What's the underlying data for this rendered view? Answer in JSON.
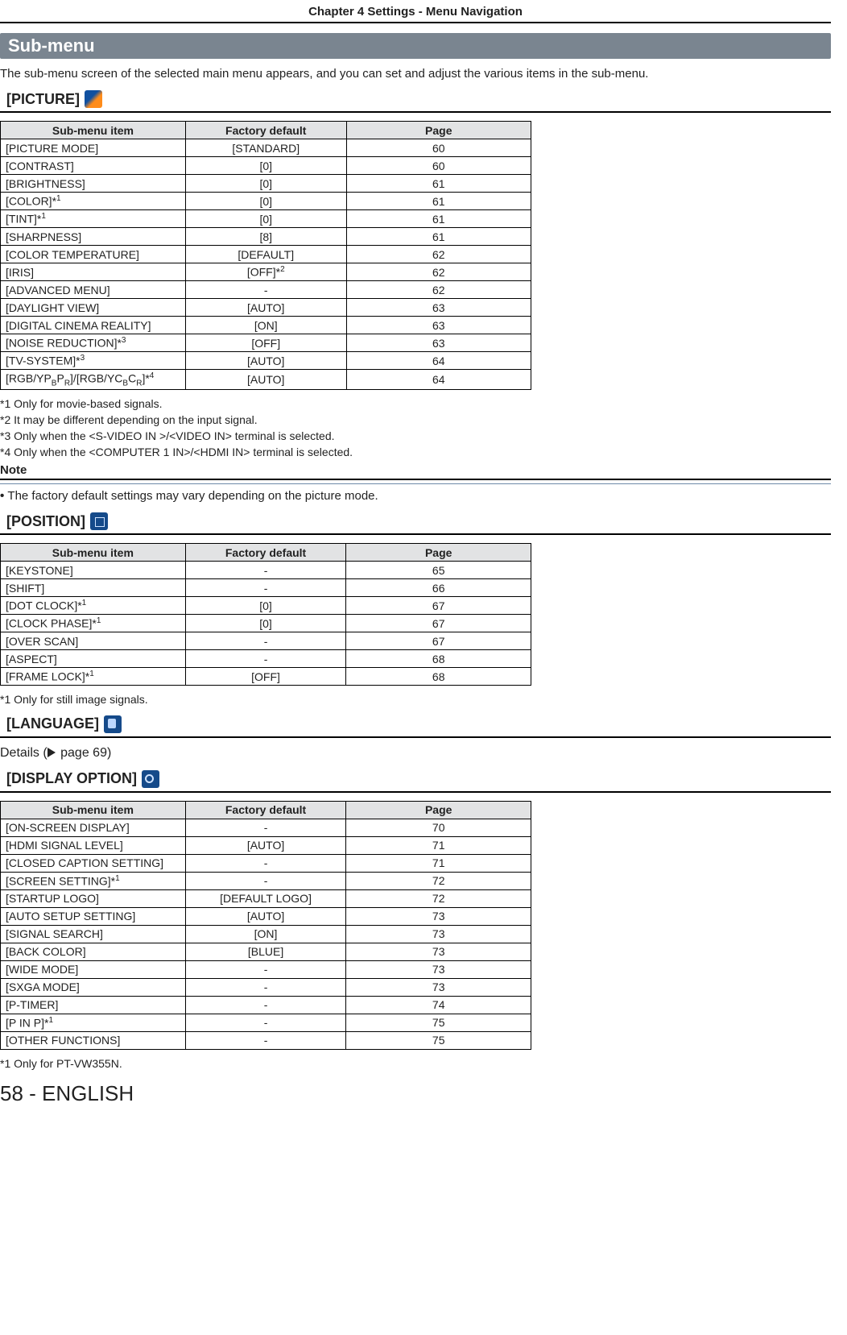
{
  "chapter_header": "Chapter 4   Settings - Menu Navigation",
  "submenu_title": "Sub-menu",
  "intro": "The sub-menu screen of the selected main menu appears, and you can set and adjust the various items in the sub-menu.",
  "table_headers": {
    "item": "Sub-menu item",
    "default": "Factory default",
    "page": "Page"
  },
  "picture": {
    "label": "[PICTURE]",
    "rows": [
      {
        "item": "[PICTURE MODE]",
        "default": "[STANDARD]",
        "page": "60"
      },
      {
        "item": "[CONTRAST]",
        "default": "[0]",
        "page": "60"
      },
      {
        "item": "[BRIGHTNESS]",
        "default": "[0]",
        "page": "61"
      },
      {
        "item": "[COLOR]*",
        "sup": "1",
        "default": "[0]",
        "page": "61"
      },
      {
        "item": "[TINT]*",
        "sup": "1",
        "default": "[0]",
        "page": "61"
      },
      {
        "item": "[SHARPNESS]",
        "default": "[8]",
        "page": "61"
      },
      {
        "item": "[COLOR TEMPERATURE]",
        "default": "[DEFAULT]",
        "page": "62"
      },
      {
        "item": "[IRIS]",
        "default": "[OFF]*",
        "def_sup": "2",
        "page": "62"
      },
      {
        "item": "[ADVANCED MENU]",
        "default": "-",
        "page": "62"
      },
      {
        "item": "[DAYLIGHT VIEW]",
        "default": "[AUTO]",
        "page": "63"
      },
      {
        "item": "[DIGITAL CINEMA REALITY]",
        "default": "[ON]",
        "page": "63"
      },
      {
        "item": "[NOISE REDUCTION]*",
        "sup": "3",
        "default": "[OFF]",
        "page": "63"
      },
      {
        "item": "[TV-SYSTEM]*",
        "sup": "3",
        "default": "[AUTO]",
        "page": "64"
      },
      {
        "item_html": "rgb",
        "default": "[AUTO]",
        "page": "64"
      }
    ],
    "rgb_parts": {
      "pre": "[RGB/YP",
      "b": "B",
      "mid": "P",
      "r": "R",
      "mid2": "]/[RGB/YC",
      "b2": "B",
      "mid3": "C",
      "r2": "R",
      "post": "]*",
      "sup": "4"
    },
    "footnotes": [
      "*1  Only for movie-based signals.",
      "*2  It may be different depending on the input signal.",
      "*3  Only when the <S-VIDEO IN >/<VIDEO IN> terminal is selected.",
      "*4  Only when the <COMPUTER 1 IN>/<HDMI IN> terminal is selected."
    ],
    "note_label": "Note",
    "note_bullet": "The factory default settings may vary depending on the picture mode."
  },
  "position": {
    "label": "[POSITION]",
    "rows": [
      {
        "item": "[KEYSTONE]",
        "default": "-",
        "page": "65"
      },
      {
        "item": "[SHIFT]",
        "default": "-",
        "page": "66"
      },
      {
        "item": "[DOT CLOCK]*",
        "sup": "1",
        "default": "[0]",
        "page": "67"
      },
      {
        "item": "[CLOCK PHASE]*",
        "sup": "1",
        "default": "[0]",
        "page": "67"
      },
      {
        "item": "[OVER SCAN]",
        "default": "-",
        "page": "67"
      },
      {
        "item": "[ASPECT]",
        "default": "-",
        "page": "68"
      },
      {
        "item": "[FRAME LOCK]*",
        "sup": "1",
        "default": "[OFF]",
        "page": "68"
      }
    ],
    "footnotes": [
      "*1   Only for still image signals."
    ]
  },
  "language": {
    "label": "[LANGUAGE]",
    "details_prefix": "Details (",
    "details_page": " page 69)",
    "details_suffix": ""
  },
  "display_option": {
    "label": "[DISPLAY OPTION]",
    "rows": [
      {
        "item": "[ON-SCREEN DISPLAY]",
        "default": "-",
        "page": "70"
      },
      {
        "item": "[HDMI SIGNAL LEVEL]",
        "default": "[AUTO]",
        "page": "71"
      },
      {
        "item": "[CLOSED CAPTION SETTING]",
        "default": "-",
        "page": "71"
      },
      {
        "item": "[SCREEN SETTING]*",
        "sup": "1",
        "default": "-",
        "page": "72"
      },
      {
        "item": "[STARTUP LOGO]",
        "default": "[DEFAULT LOGO]",
        "page": "72"
      },
      {
        "item": "[AUTO SETUP SETTING]",
        "default": "[AUTO]",
        "page": "73"
      },
      {
        "item": "[SIGNAL SEARCH]",
        "default": "[ON]",
        "page": "73"
      },
      {
        "item": "[BACK COLOR]",
        "default": "[BLUE]",
        "page": "73"
      },
      {
        "item": "[WIDE MODE]",
        "default": "-",
        "page": "73"
      },
      {
        "item": "[SXGA MODE]",
        "default": "-",
        "page": "73"
      },
      {
        "item": "[P-TIMER]",
        "default": "-",
        "page": "74"
      },
      {
        "item": "[P IN P]*",
        "sup": "1",
        "default": "-",
        "page": "75"
      },
      {
        "item": "[OTHER FUNCTIONS]",
        "default": "-",
        "page": "75"
      }
    ],
    "footnotes": [
      "*1   Only for PT-VW355N."
    ]
  },
  "page_footer": "58 - ENGLISH"
}
